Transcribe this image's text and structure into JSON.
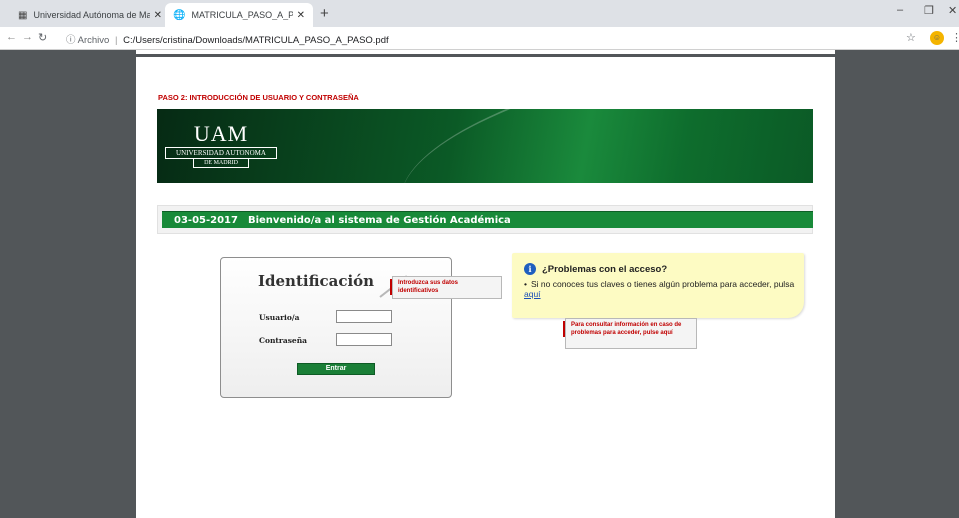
{
  "browser": {
    "tabs": [
      {
        "label": "Universidad Autónoma de Madr",
        "active": false
      },
      {
        "label": "MATRICULA_PASO_A_PASO.pdf",
        "active": true
      }
    ],
    "new_tab": "+",
    "window_controls": {
      "minimize": "–",
      "restore": "❐",
      "close": "✕"
    },
    "address": {
      "scheme_label": "Archivo",
      "separator": "|",
      "path": "C:/Users/cristina/Downloads/MATRICULA_PASO_A_PASO.pdf"
    }
  },
  "document": {
    "step_title": "PASO 2: INTRODUCCIÓN DE USUARIO Y CONTRASEÑA",
    "logo": {
      "acronym": "UAM",
      "line1": "UNIVERSIDAD AUTONOMA",
      "line2": "DE MADRID"
    },
    "welcome": {
      "date": "03-05-2017",
      "message": "Bienvenido/a al sistema de Gestión Académica"
    },
    "login": {
      "heading": "Identificación",
      "user_label": "Usuario/a",
      "password_label": "Contraseña",
      "user_value": "",
      "password_value": "",
      "submit_label": "Entrar"
    },
    "callout_credentials": "Introduzca sus datos identificativos",
    "problems": {
      "title": "¿Problemas con el acceso?",
      "text": "Si no conoces tus claves o tienes algún problema para acceder, pulsa",
      "link_label": "aquí"
    },
    "callout_help": "Para consultar información en caso de problemas para acceder, pulse aquí"
  },
  "colors": {
    "accent_green": "#188a39",
    "callout_red": "#c00000",
    "note_yellow": "#fdfbc3",
    "viewer_bg": "#525659"
  }
}
